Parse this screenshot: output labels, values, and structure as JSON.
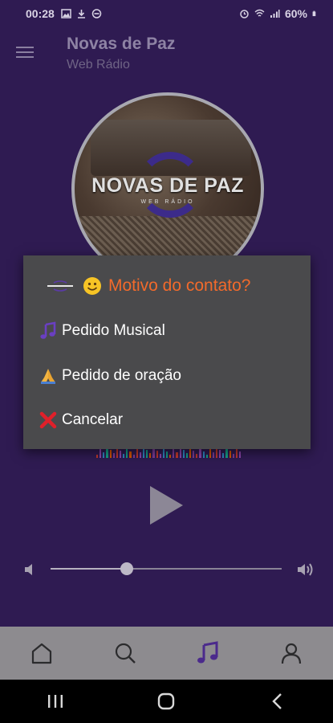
{
  "status_bar": {
    "time": "00:28",
    "battery": "60%"
  },
  "header": {
    "title": "Novas de Paz",
    "subtitle": "Web Rádio"
  },
  "cover": {
    "logo_text": "NOVAS DE PAZ",
    "logo_sub": "WEB RÁDIO"
  },
  "volume": {
    "level": 0.33
  },
  "dialog": {
    "title": "Motivo do contato?",
    "options": [
      {
        "label": "Pedido Musical",
        "icon": "music-note-icon"
      },
      {
        "label": "Pedido de oração",
        "icon": "praying-hands-icon"
      },
      {
        "label": "Cancelar",
        "icon": "red-x-icon"
      }
    ]
  },
  "bottom_nav": {
    "items": [
      "home-icon",
      "search-icon",
      "music-icon",
      "profile-icon"
    ],
    "active_index": 2
  },
  "colors": {
    "background": "#2f1b52",
    "dialog": "#4a4a4c",
    "title_accent": "#f26a2b",
    "nav_active": "#4b2a8c"
  }
}
